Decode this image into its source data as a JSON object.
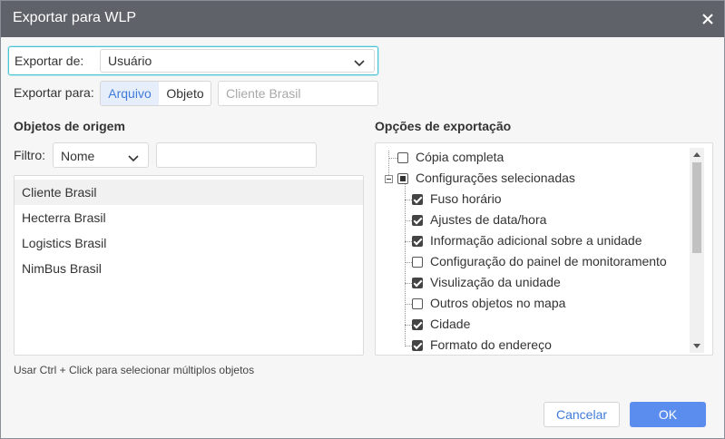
{
  "dialog": {
    "title": "Exportar para WLP",
    "export_from": {
      "label": "Exportar de:",
      "value": "Usuário"
    },
    "export_to": {
      "label": "Exportar para:",
      "options": [
        "Arquivo",
        "Objeto"
      ],
      "active": "Arquivo",
      "target_placeholder": "Cliente Brasil"
    },
    "source": {
      "title": "Objetos de origem",
      "filter_label": "Filtro:",
      "filter_select": "Nome",
      "filter_input": "",
      "items": [
        "Cliente Brasil",
        "Hecterra Brasil",
        "Logistics Brasil",
        "NimBus Brasil"
      ],
      "selected_index": 0
    },
    "options": {
      "title": "Opções de exportação",
      "full_copy": {
        "label": "Cópia completa",
        "checked": false
      },
      "selected": {
        "label": "Configurações selecionadas",
        "state": "partial",
        "children": [
          {
            "label": "Fuso horário",
            "checked": true
          },
          {
            "label": "Ajustes de data/hora",
            "checked": true
          },
          {
            "label": "Informação adicional sobre a unidade",
            "checked": true
          },
          {
            "label": "Configuração do painel de monitoramento",
            "checked": false
          },
          {
            "label": "Visulização da unidade",
            "checked": true
          },
          {
            "label": "Outros objetos no mapa",
            "checked": false
          },
          {
            "label": "Cidade",
            "checked": true
          },
          {
            "label": "Formato do endereço",
            "checked": true
          }
        ]
      }
    },
    "hint": "Usar Ctrl + Click para selecionar múltiplos objetos",
    "buttons": {
      "cancel": "Cancelar",
      "ok": "OK"
    },
    "colors": {
      "accent": "#5b8def",
      "focus": "#4fc3d4",
      "titlebar": "#5f6369"
    }
  }
}
